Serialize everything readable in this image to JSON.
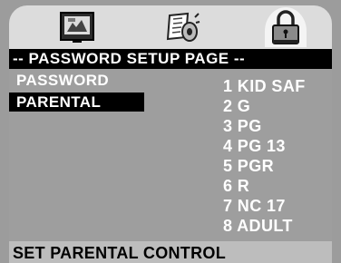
{
  "tabs": [
    {
      "name": "general-setup-icon"
    },
    {
      "name": "audio-setup-icon"
    },
    {
      "name": "lock-icon"
    }
  ],
  "header": {
    "title": "-- PASSWORD SETUP PAGE --"
  },
  "menu": {
    "items": [
      "PASSWORD",
      "PARENTAL"
    ],
    "selected": "PARENTAL"
  },
  "options": [
    "1 KID SAF",
    "2 G",
    "3 PG",
    "4 PG 13",
    "5 PGR",
    "6 R",
    "7 NC 17",
    "8 ADULT"
  ],
  "status": {
    "text": "SET PARENTAL CONTROL"
  }
}
